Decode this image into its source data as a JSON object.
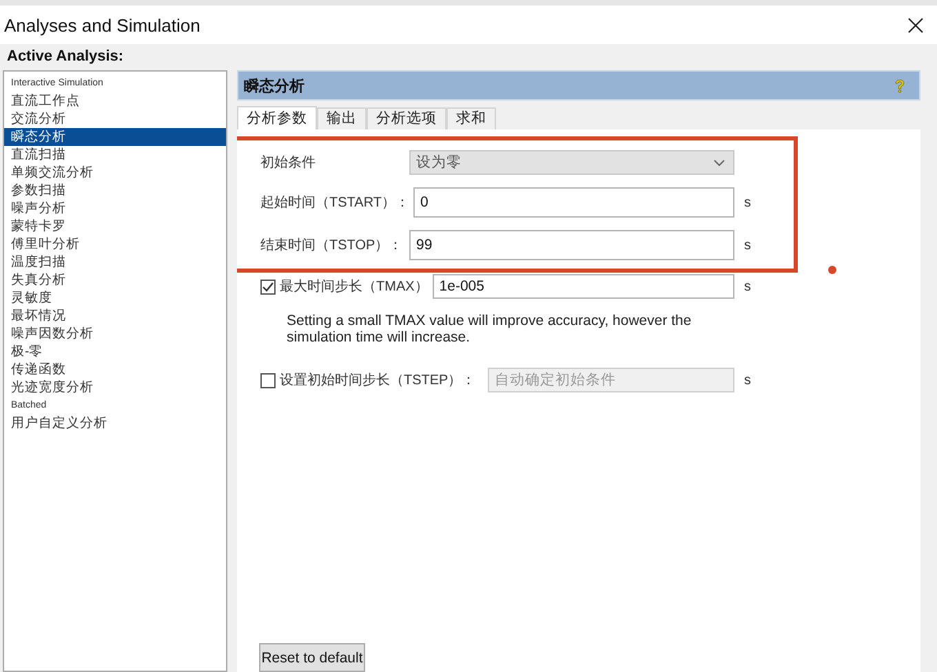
{
  "window": {
    "title": "Analyses and Simulation"
  },
  "active_analysis_label": "Active Analysis:",
  "analyses": [
    {
      "label": "Interactive Simulation",
      "selected": false
    },
    {
      "label": "直流工作点",
      "selected": false
    },
    {
      "label": "交流分析",
      "selected": false
    },
    {
      "label": "瞬态分析",
      "selected": true
    },
    {
      "label": "直流扫描",
      "selected": false
    },
    {
      "label": "单频交流分析",
      "selected": false
    },
    {
      "label": "参数扫描",
      "selected": false
    },
    {
      "label": "噪声分析",
      "selected": false
    },
    {
      "label": "蒙特卡罗",
      "selected": false
    },
    {
      "label": "傅里叶分析",
      "selected": false
    },
    {
      "label": "温度扫描",
      "selected": false
    },
    {
      "label": "失真分析",
      "selected": false
    },
    {
      "label": "灵敏度",
      "selected": false
    },
    {
      "label": "最坏情况",
      "selected": false
    },
    {
      "label": "噪声因数分析",
      "selected": false
    },
    {
      "label": "极-零",
      "selected": false
    },
    {
      "label": "传递函数",
      "selected": false
    },
    {
      "label": "光迹宽度分析",
      "selected": false
    },
    {
      "label": "Batched",
      "selected": false
    },
    {
      "label": "用户自定义分析",
      "selected": false
    }
  ],
  "panel": {
    "title": "瞬态分析",
    "tabs": [
      {
        "label": "分析参数",
        "selected": true
      },
      {
        "label": "输出",
        "selected": false
      },
      {
        "label": "分析选项",
        "selected": false
      },
      {
        "label": "求和",
        "selected": false
      }
    ],
    "fields": [
      {
        "kind": "select",
        "label": "初始条件",
        "value": "设为零"
      },
      {
        "kind": "input",
        "label": "起始时间（TSTART）：",
        "value": "0",
        "unit": "s"
      },
      {
        "kind": "input",
        "label": "结束时间（TSTOP）：",
        "value": "99",
        "unit": "s"
      }
    ],
    "options": [
      {
        "label": "最大时间步长（TMAX）",
        "checked": true,
        "disabled": false,
        "value": "1e-005",
        "unit": "s",
        "note": "Setting a small TMAX value will improve accuracy, however the simulation time will increase."
      },
      {
        "label": "设置初始时间步长（TSTEP）：",
        "checked": false,
        "disabled": true,
        "value": "自动确定初始条件",
        "unit": "s"
      }
    ],
    "reset_button": "Reset to default"
  },
  "highlight_frame": {
    "color": "#d9472b"
  },
  "marker_dot": {
    "color": "#d9472b"
  }
}
